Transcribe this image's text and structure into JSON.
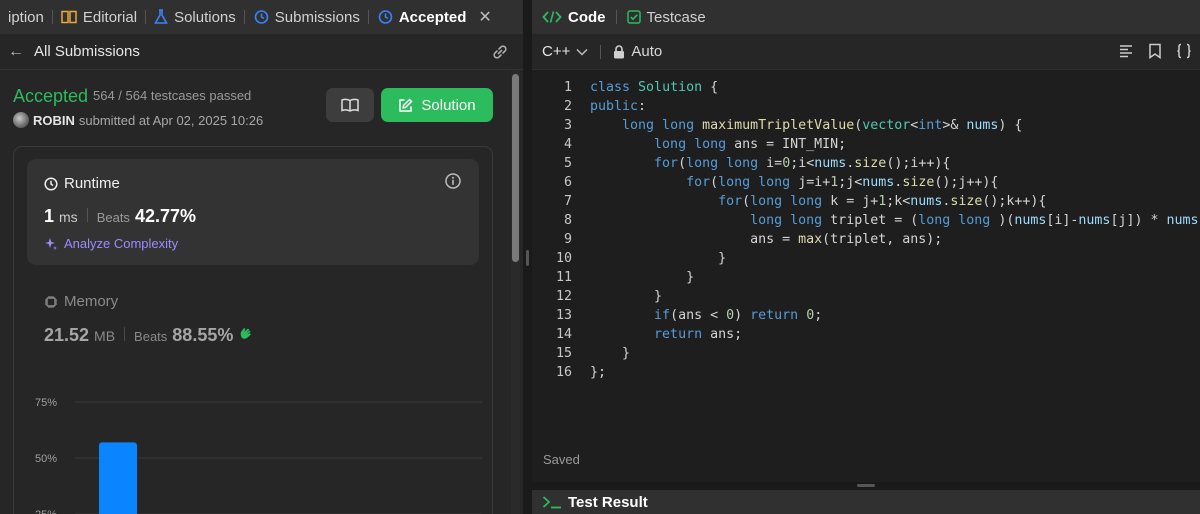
{
  "left_tabs": {
    "description": "iption",
    "editorial": "Editorial",
    "solutions": "Solutions",
    "submissions": "Submissions",
    "accepted": "Accepted"
  },
  "subbar": {
    "title": "All Submissions"
  },
  "result": {
    "status": "Accepted",
    "passed": "564 / 564 testcases passed",
    "user": "ROBIN",
    "submitted": "submitted at Apr 02, 2025 10:26"
  },
  "actions": {
    "solution_label": "Solution"
  },
  "runtime": {
    "title": "Runtime",
    "value": "1",
    "unit": "ms",
    "beats_label": "Beats",
    "beats_pct": "42.77%",
    "analyze": "Analyze Complexity"
  },
  "memory": {
    "title": "Memory",
    "value": "21.52",
    "unit": "MB",
    "beats_label": "Beats",
    "beats_pct": "88.55%"
  },
  "chart_data": {
    "type": "bar",
    "ytick_labels": [
      "75%",
      "50%",
      "25%"
    ],
    "yticks": [
      75,
      50,
      25
    ],
    "bar_value": 57,
    "ylim": [
      0,
      100
    ]
  },
  "right_tabs": {
    "code": "Code",
    "testcase": "Testcase"
  },
  "editor": {
    "language": "C++",
    "mode": "Auto",
    "status": "Saved",
    "lines": [
      "1",
      "2",
      "3",
      "4",
      "5",
      "6",
      "7",
      "8",
      "9",
      "10",
      "11",
      "12",
      "13",
      "14",
      "15",
      "16"
    ]
  },
  "bottom": {
    "test_result": "Test Result"
  },
  "colors": {
    "accent_green": "#2cbb5d",
    "accent_blue": "#3b82f6",
    "analyze_purple": "#9b8cff"
  }
}
